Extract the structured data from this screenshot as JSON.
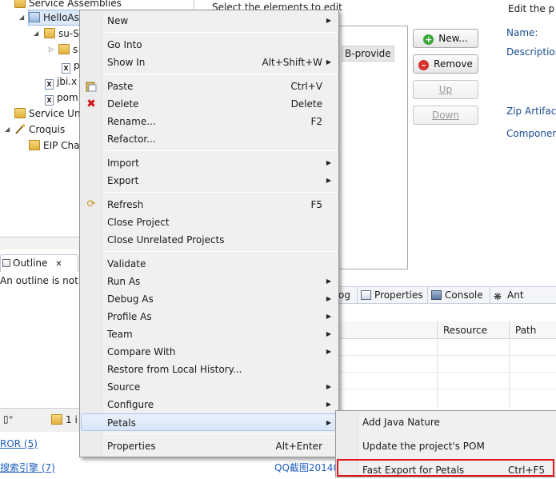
{
  "explorer": {
    "rows": [
      {
        "label": "Service Assemblies",
        "icon": "folder-icon"
      },
      {
        "label": "HelloAs",
        "icon": "project-icon"
      },
      {
        "label": "su-S",
        "icon": "folder-icon"
      },
      {
        "label": "s",
        "icon": "folder-icon"
      },
      {
        "label": "p",
        "icon": "xml-file-icon"
      },
      {
        "label": "jbi.x",
        "icon": "xml-file-icon"
      },
      {
        "label": "pom",
        "icon": "xml-file-icon"
      },
      {
        "label": "Service Un",
        "icon": "folder-icon"
      },
      {
        "label": "Croquis",
        "icon": "wand-icon"
      },
      {
        "label": "EIP Cha",
        "icon": "folder-icon"
      }
    ]
  },
  "outline": {
    "tab_label": "Outline",
    "close_glyph": "✕",
    "message": "An outline is not a"
  },
  "editor": {
    "hint": "Select the elements to edit",
    "list_item": "B-provide",
    "buttons": {
      "new": "New...",
      "remove": "Remove",
      "up": "Up",
      "down": "Down"
    },
    "right_title": "Edit the p",
    "labels": {
      "name": "Name:",
      "description": "Description",
      "zip": "Zip Artifact",
      "component": "Componer"
    }
  },
  "views": {
    "tabs": [
      "og",
      "Properties",
      "Console",
      "Ant"
    ],
    "columns": [
      "Resource",
      "Path"
    ]
  },
  "bottom": {
    "toolbar_text": "1 i",
    "error_link": "ROR (5)",
    "search_link": "搜索引擎 (7)",
    "qq_text": "QQ截图20140"
  },
  "context_menu": {
    "items": [
      {
        "label": "New",
        "submenu": true
      },
      {
        "label": "Go Into"
      },
      {
        "label": "Show In",
        "accel": "Alt+Shift+W",
        "submenu": true
      },
      {
        "label": "Paste",
        "accel": "Ctrl+V",
        "icon": "paste-icon"
      },
      {
        "label": "Delete",
        "accel": "Delete",
        "icon": "delete-icon"
      },
      {
        "label": "Rename...",
        "accel": "F2"
      },
      {
        "label": "Refactor..."
      },
      {
        "label": "Import",
        "submenu": true
      },
      {
        "label": "Export",
        "submenu": true
      },
      {
        "label": "Refresh",
        "accel": "F5",
        "icon": "refresh-icon"
      },
      {
        "label": "Close Project"
      },
      {
        "label": "Close Unrelated Projects"
      },
      {
        "label": "Validate"
      },
      {
        "label": "Run As",
        "submenu": true
      },
      {
        "label": "Debug As",
        "submenu": true
      },
      {
        "label": "Profile As",
        "submenu": true
      },
      {
        "label": "Team",
        "submenu": true
      },
      {
        "label": "Compare With",
        "submenu": true
      },
      {
        "label": "Restore from Local History..."
      },
      {
        "label": "Source",
        "submenu": true
      },
      {
        "label": "Configure",
        "submenu": true
      },
      {
        "label": "Petals",
        "submenu": true
      },
      {
        "label": "Properties",
        "accel": "Alt+Enter"
      }
    ]
  },
  "petals_submenu": {
    "items": [
      {
        "label": "Add Java Nature"
      },
      {
        "label": "Update the project's POM"
      },
      {
        "label": "Fast Export for Petals",
        "accel": "Ctrl+F5"
      }
    ]
  },
  "colors": {
    "highlight_box": "#e0151c",
    "link": "#1f5fbf",
    "menu_bg": "#f0f0f0"
  }
}
